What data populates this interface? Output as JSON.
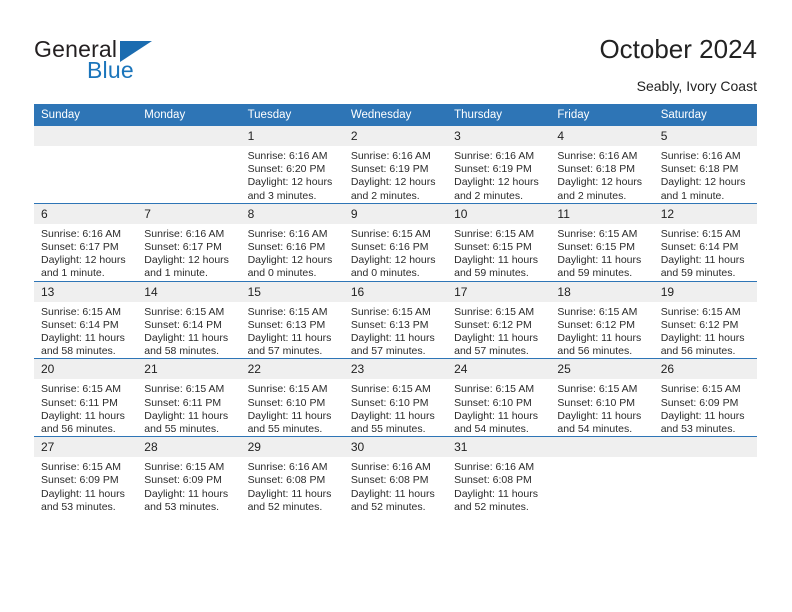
{
  "brand": {
    "name_top": "General",
    "name_bottom": "Blue",
    "accent_color": "#1b6cb0"
  },
  "header": {
    "title": "October 2024",
    "subtitle": "Seably, Ivory Coast"
  },
  "calendar": {
    "header_bg": "#2e75b6",
    "daynum_bg": "#efefef",
    "weekday_labels": [
      "Sunday",
      "Monday",
      "Tuesday",
      "Wednesday",
      "Thursday",
      "Friday",
      "Saturday"
    ],
    "weeks": [
      [
        {
          "day": "",
          "sunrise": "",
          "sunset": "",
          "daylight": ""
        },
        {
          "day": "",
          "sunrise": "",
          "sunset": "",
          "daylight": ""
        },
        {
          "day": "1",
          "sunrise": "Sunrise: 6:16 AM",
          "sunset": "Sunset: 6:20 PM",
          "daylight": "Daylight: 12 hours and 3 minutes."
        },
        {
          "day": "2",
          "sunrise": "Sunrise: 6:16 AM",
          "sunset": "Sunset: 6:19 PM",
          "daylight": "Daylight: 12 hours and 2 minutes."
        },
        {
          "day": "3",
          "sunrise": "Sunrise: 6:16 AM",
          "sunset": "Sunset: 6:19 PM",
          "daylight": "Daylight: 12 hours and 2 minutes."
        },
        {
          "day": "4",
          "sunrise": "Sunrise: 6:16 AM",
          "sunset": "Sunset: 6:18 PM",
          "daylight": "Daylight: 12 hours and 2 minutes."
        },
        {
          "day": "5",
          "sunrise": "Sunrise: 6:16 AM",
          "sunset": "Sunset: 6:18 PM",
          "daylight": "Daylight: 12 hours and 1 minute."
        }
      ],
      [
        {
          "day": "6",
          "sunrise": "Sunrise: 6:16 AM",
          "sunset": "Sunset: 6:17 PM",
          "daylight": "Daylight: 12 hours and 1 minute."
        },
        {
          "day": "7",
          "sunrise": "Sunrise: 6:16 AM",
          "sunset": "Sunset: 6:17 PM",
          "daylight": "Daylight: 12 hours and 1 minute."
        },
        {
          "day": "8",
          "sunrise": "Sunrise: 6:16 AM",
          "sunset": "Sunset: 6:16 PM",
          "daylight": "Daylight: 12 hours and 0 minutes."
        },
        {
          "day": "9",
          "sunrise": "Sunrise: 6:15 AM",
          "sunset": "Sunset: 6:16 PM",
          "daylight": "Daylight: 12 hours and 0 minutes."
        },
        {
          "day": "10",
          "sunrise": "Sunrise: 6:15 AM",
          "sunset": "Sunset: 6:15 PM",
          "daylight": "Daylight: 11 hours and 59 minutes."
        },
        {
          "day": "11",
          "sunrise": "Sunrise: 6:15 AM",
          "sunset": "Sunset: 6:15 PM",
          "daylight": "Daylight: 11 hours and 59 minutes."
        },
        {
          "day": "12",
          "sunrise": "Sunrise: 6:15 AM",
          "sunset": "Sunset: 6:14 PM",
          "daylight": "Daylight: 11 hours and 59 minutes."
        }
      ],
      [
        {
          "day": "13",
          "sunrise": "Sunrise: 6:15 AM",
          "sunset": "Sunset: 6:14 PM",
          "daylight": "Daylight: 11 hours and 58 minutes."
        },
        {
          "day": "14",
          "sunrise": "Sunrise: 6:15 AM",
          "sunset": "Sunset: 6:14 PM",
          "daylight": "Daylight: 11 hours and 58 minutes."
        },
        {
          "day": "15",
          "sunrise": "Sunrise: 6:15 AM",
          "sunset": "Sunset: 6:13 PM",
          "daylight": "Daylight: 11 hours and 57 minutes."
        },
        {
          "day": "16",
          "sunrise": "Sunrise: 6:15 AM",
          "sunset": "Sunset: 6:13 PM",
          "daylight": "Daylight: 11 hours and 57 minutes."
        },
        {
          "day": "17",
          "sunrise": "Sunrise: 6:15 AM",
          "sunset": "Sunset: 6:12 PM",
          "daylight": "Daylight: 11 hours and 57 minutes."
        },
        {
          "day": "18",
          "sunrise": "Sunrise: 6:15 AM",
          "sunset": "Sunset: 6:12 PM",
          "daylight": "Daylight: 11 hours and 56 minutes."
        },
        {
          "day": "19",
          "sunrise": "Sunrise: 6:15 AM",
          "sunset": "Sunset: 6:12 PM",
          "daylight": "Daylight: 11 hours and 56 minutes."
        }
      ],
      [
        {
          "day": "20",
          "sunrise": "Sunrise: 6:15 AM",
          "sunset": "Sunset: 6:11 PM",
          "daylight": "Daylight: 11 hours and 56 minutes."
        },
        {
          "day": "21",
          "sunrise": "Sunrise: 6:15 AM",
          "sunset": "Sunset: 6:11 PM",
          "daylight": "Daylight: 11 hours and 55 minutes."
        },
        {
          "day": "22",
          "sunrise": "Sunrise: 6:15 AM",
          "sunset": "Sunset: 6:10 PM",
          "daylight": "Daylight: 11 hours and 55 minutes."
        },
        {
          "day": "23",
          "sunrise": "Sunrise: 6:15 AM",
          "sunset": "Sunset: 6:10 PM",
          "daylight": "Daylight: 11 hours and 55 minutes."
        },
        {
          "day": "24",
          "sunrise": "Sunrise: 6:15 AM",
          "sunset": "Sunset: 6:10 PM",
          "daylight": "Daylight: 11 hours and 54 minutes."
        },
        {
          "day": "25",
          "sunrise": "Sunrise: 6:15 AM",
          "sunset": "Sunset: 6:10 PM",
          "daylight": "Daylight: 11 hours and 54 minutes."
        },
        {
          "day": "26",
          "sunrise": "Sunrise: 6:15 AM",
          "sunset": "Sunset: 6:09 PM",
          "daylight": "Daylight: 11 hours and 53 minutes."
        }
      ],
      [
        {
          "day": "27",
          "sunrise": "Sunrise: 6:15 AM",
          "sunset": "Sunset: 6:09 PM",
          "daylight": "Daylight: 11 hours and 53 minutes."
        },
        {
          "day": "28",
          "sunrise": "Sunrise: 6:15 AM",
          "sunset": "Sunset: 6:09 PM",
          "daylight": "Daylight: 11 hours and 53 minutes."
        },
        {
          "day": "29",
          "sunrise": "Sunrise: 6:16 AM",
          "sunset": "Sunset: 6:08 PM",
          "daylight": "Daylight: 11 hours and 52 minutes."
        },
        {
          "day": "30",
          "sunrise": "Sunrise: 6:16 AM",
          "sunset": "Sunset: 6:08 PM",
          "daylight": "Daylight: 11 hours and 52 minutes."
        },
        {
          "day": "31",
          "sunrise": "Sunrise: 6:16 AM",
          "sunset": "Sunset: 6:08 PM",
          "daylight": "Daylight: 11 hours and 52 minutes."
        },
        {
          "day": "",
          "sunrise": "",
          "sunset": "",
          "daylight": ""
        },
        {
          "day": "",
          "sunrise": "",
          "sunset": "",
          "daylight": ""
        }
      ]
    ]
  }
}
